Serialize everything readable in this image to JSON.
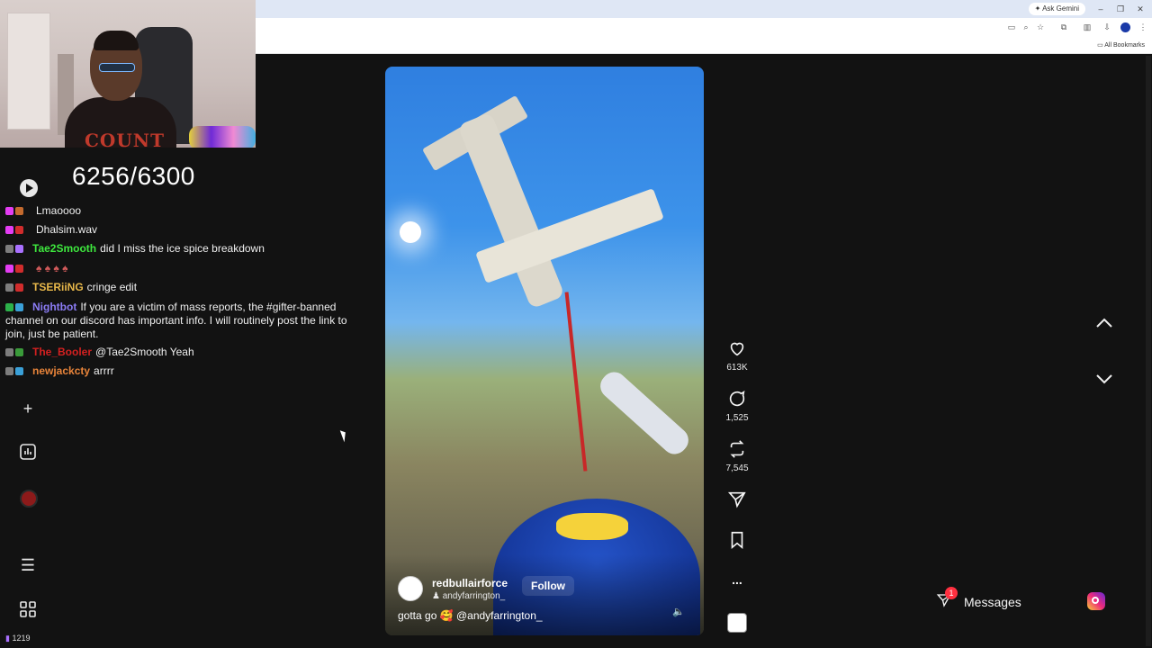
{
  "browser": {
    "ask_gemini": "Ask Gemini",
    "all_bookmarks": "All Bookmarks"
  },
  "stream": {
    "counter": "6256/6300",
    "viewer_count": "1219",
    "webcam_shirt_text": "COUNT"
  },
  "chat": [
    {
      "user": "",
      "user_color": "#2a2ad8",
      "message": "Lmaoooo"
    },
    {
      "user": "",
      "user_color": "#2a2ad8",
      "message": "Dhalsim.wav"
    },
    {
      "user": "Tae2Smooth",
      "user_color": "#3ee83e",
      "message": "did I miss the ice spice breakdown"
    },
    {
      "user": "",
      "user_color": "#b0212a",
      "message": ""
    },
    {
      "user": "TSERiiNG",
      "user_color": "#e8b84a",
      "message": "cringe edit"
    },
    {
      "user": "Nightbot",
      "user_color": "#8b7cf4",
      "message": "If you are a victim of mass reports, the #gifter-banned channel on our discord has important info. I will routinely post the link to join, just be patient."
    },
    {
      "user": "The_Booler",
      "user_color": "#d42020",
      "message": "@Tae2Smooth Yeah"
    },
    {
      "user": "newjackcty",
      "user_color": "#e8843a",
      "message": "arrrr"
    }
  ],
  "video": {
    "account": "redbullairforce",
    "collab": "andyfarrington_",
    "follow_label": "Follow",
    "caption": "gotta go 🥰 @andyfarrington_"
  },
  "actions": {
    "likes": "613K",
    "comments": "1,525",
    "reposts": "7,545",
    "more": "..."
  },
  "messages": {
    "label": "Messages",
    "badge": "1"
  }
}
